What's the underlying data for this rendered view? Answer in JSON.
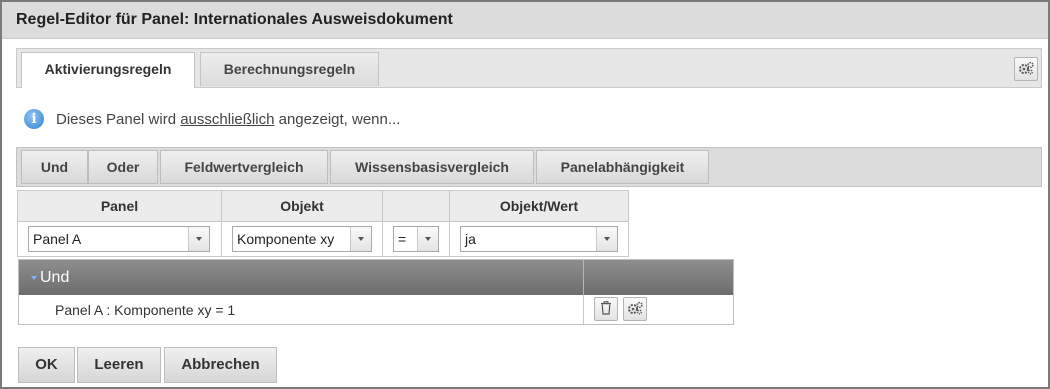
{
  "window": {
    "title": "Regel-Editor für Panel: Internationales Ausweisdokument"
  },
  "tabs": [
    {
      "label": "Aktivierungsregeln",
      "active": true
    },
    {
      "label": "Berechnungsregeln",
      "active": false
    }
  ],
  "tab_settings_icon": "gear-icon",
  "info": {
    "icon": "info-icon",
    "text_before": "Dieses Panel wird ",
    "emphasis": "ausschließlich",
    "text_after": " angezeigt, wenn..."
  },
  "toolbar": {
    "buttons": [
      "Und",
      "Oder",
      "Feldwertvergleich",
      "Wissensbasisvergleich",
      "Panelabhängigkeit"
    ]
  },
  "condition_table": {
    "headers": [
      "Panel",
      "Objekt",
      "",
      "Objekt/Wert"
    ],
    "selects": {
      "panel": "Panel A",
      "object": "Komponente xy",
      "operator": "=",
      "value": "ja"
    }
  },
  "rule_group": {
    "title": "Und",
    "rule": "Panel A : Komponente xy = 1",
    "icons": [
      "trash-icon",
      "gear-icon"
    ]
  },
  "footer": {
    "ok": "OK",
    "clear": "Leeren",
    "cancel": "Abbrechen"
  }
}
